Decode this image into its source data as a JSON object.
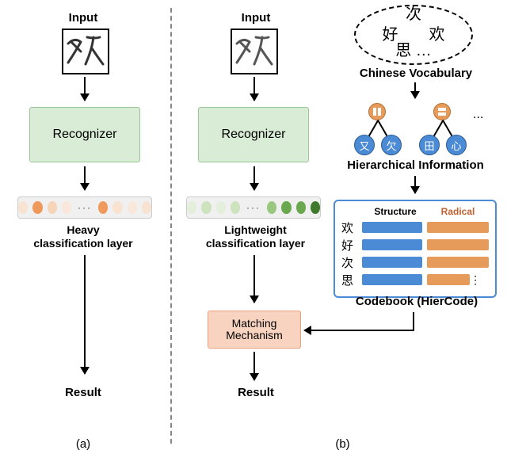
{
  "labels": {
    "input": "Input",
    "recognizer": "Recognizer",
    "heavy_cls": "Heavy\nclassification layer",
    "light_cls": "Lightweight\nclassification layer",
    "result": "Result",
    "panel_a": "(a)",
    "panel_b": "(b)",
    "vocab": "Chinese Vocabulary",
    "hier": "Hierarchical Information",
    "matching": "Matching\nMechanism",
    "codebook_title": "Codebook (HierCode)"
  },
  "vocab_chars": [
    "好",
    "次",
    "欢",
    "思",
    "…"
  ],
  "tree1_children": [
    "又",
    "欠"
  ],
  "tree2_children": [
    "田",
    "心"
  ],
  "codebook": {
    "header_structure": "Structure",
    "header_radical": "Radical",
    "rows": [
      "欢",
      "好",
      "次",
      "思"
    ]
  },
  "dots_orange": [
    "#f8e3d2",
    "#ef9a5c",
    "#f6d4b8",
    "#f8e7da",
    "#ef9a5c",
    "#f8e3d2",
    "#f8e7da",
    "#f8e3d2"
  ],
  "dots_green": [
    "#e3efda",
    "#cde3bd",
    "#e3efda",
    "#cde3bd",
    "#9ac77f",
    "#6aa84f",
    "#6aa84f",
    "#3f7a2c"
  ],
  "chart_data": {
    "type": "diagram",
    "description": "Comparison of (a) conventional heavy-classifier recognizer and (b) lightweight recognizer + HierCode codebook with matching mechanism, fed by Chinese vocabulary hierarchical information.",
    "panels": [
      {
        "id": "a",
        "pipeline": [
          "Input",
          "Recognizer",
          "Heavy classification layer",
          "Result"
        ]
      },
      {
        "id": "b",
        "pipeline": [
          "Input",
          "Recognizer",
          "Lightweight classification layer",
          "Matching Mechanism",
          "Result"
        ],
        "side_input": [
          "Chinese Vocabulary",
          "Hierarchical Information",
          "Codebook (HierCode)",
          "Matching Mechanism"
        ]
      }
    ]
  }
}
